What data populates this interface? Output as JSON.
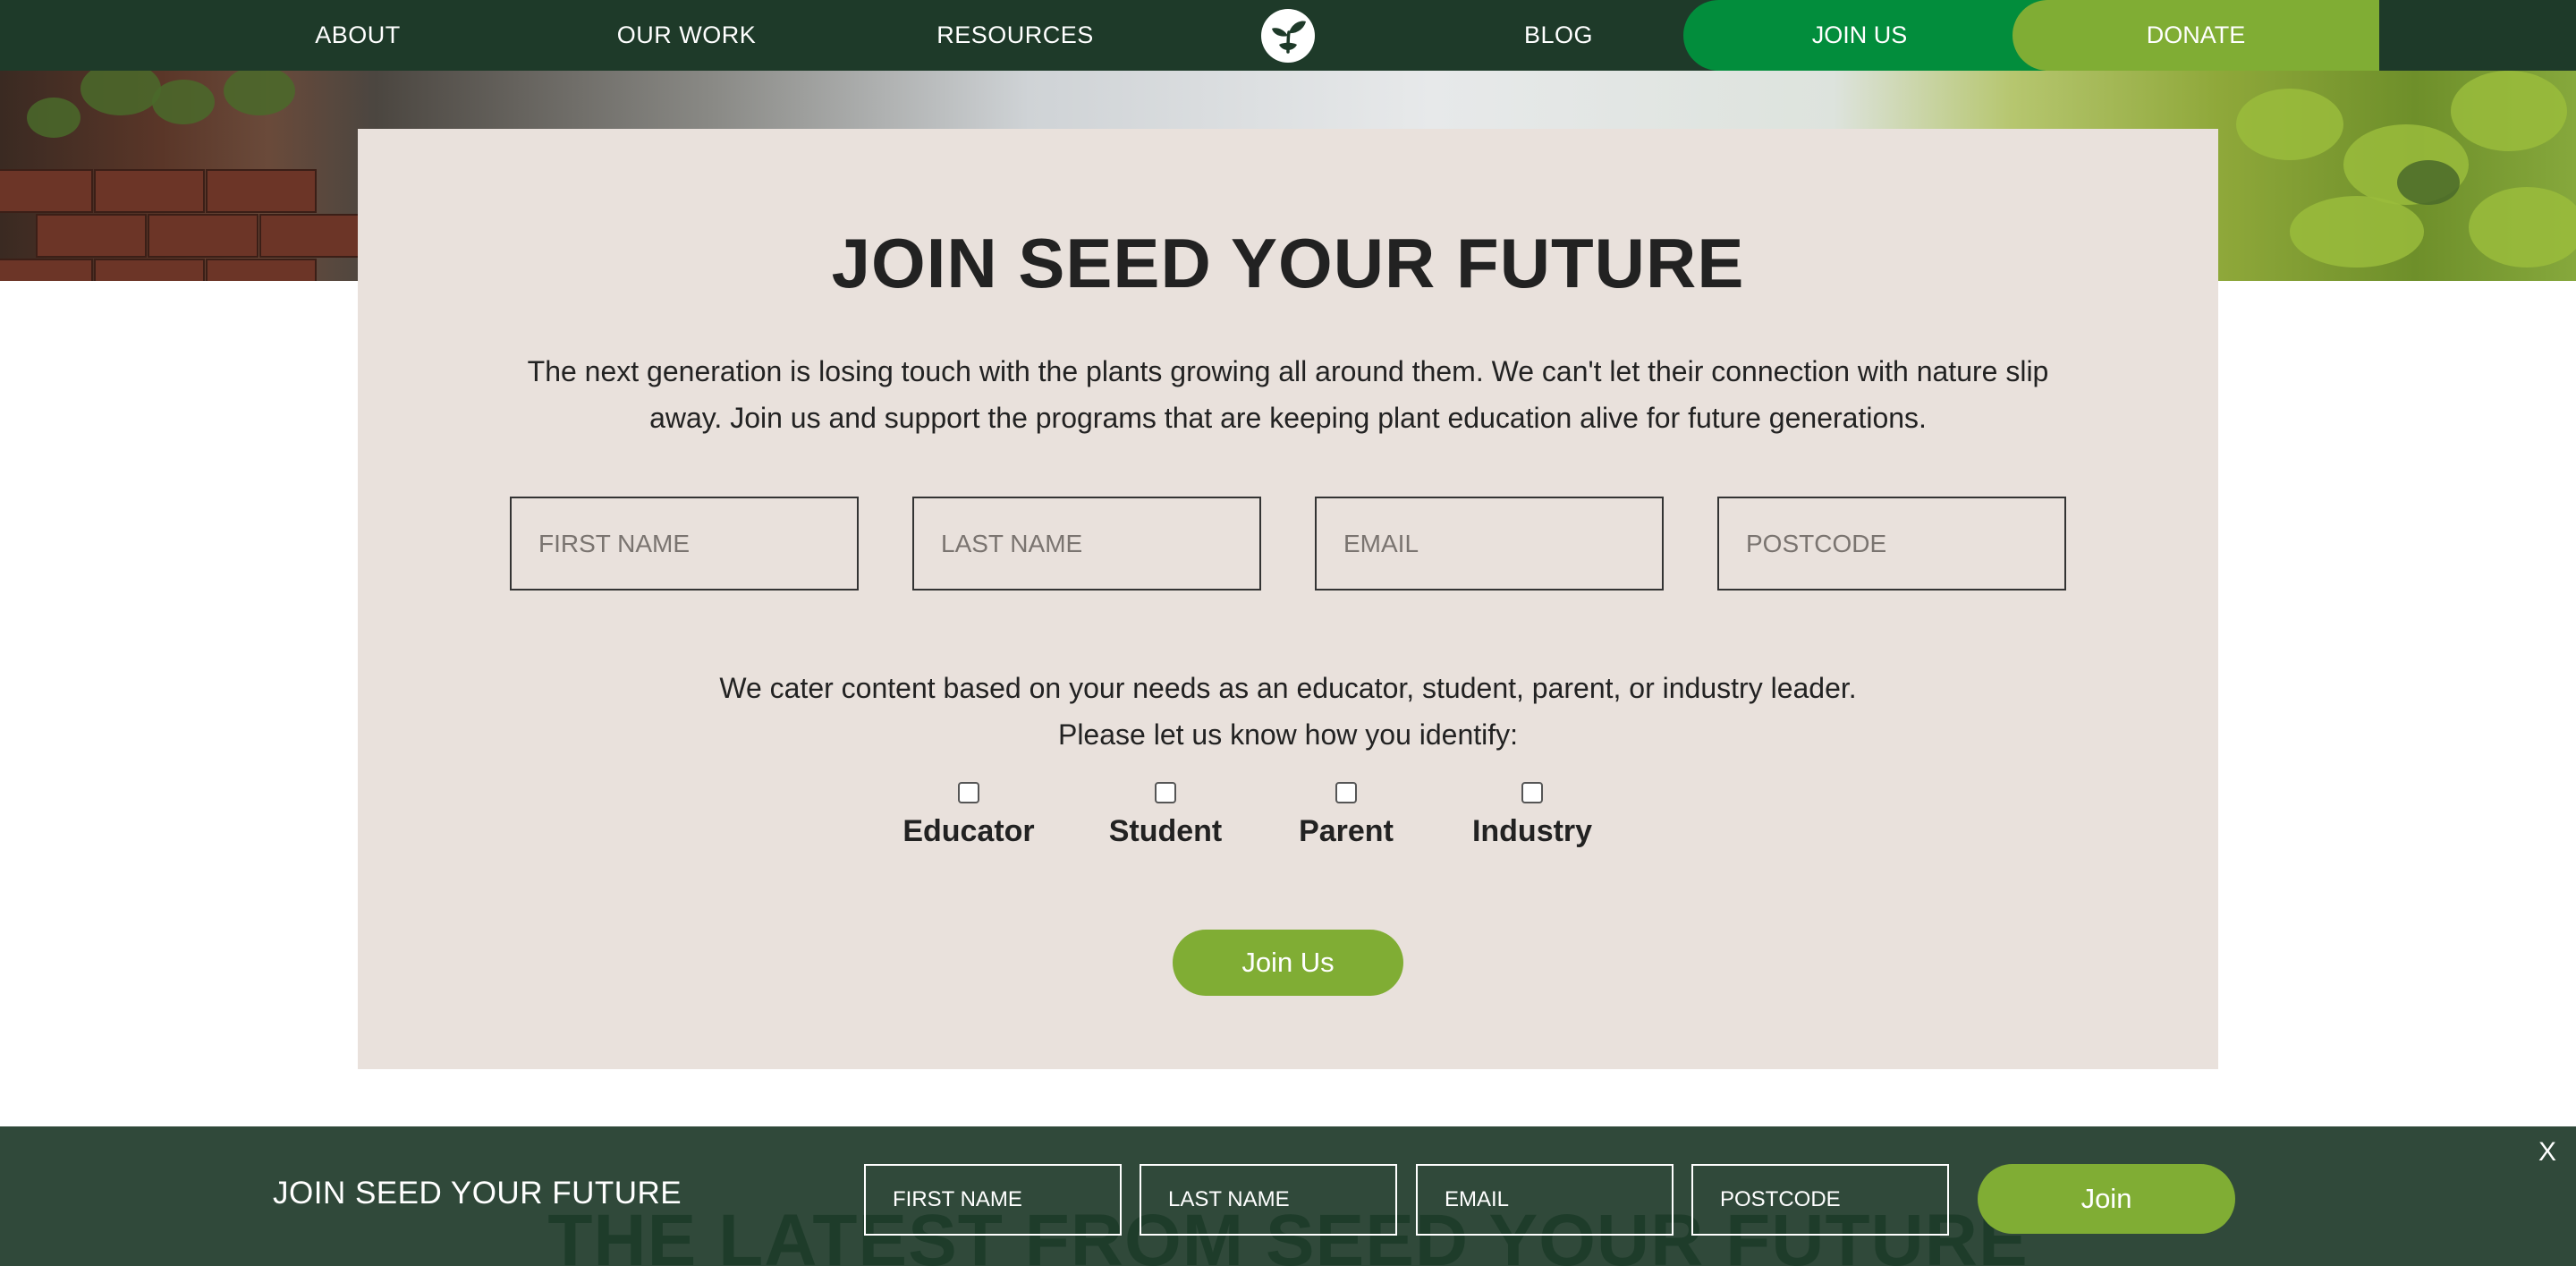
{
  "nav": {
    "about": "ABOUT",
    "our_work": "OUR WORK",
    "resources": "RESOURCES",
    "blog": "BLOG",
    "join_us": "JOIN US",
    "donate": "DONATE",
    "logo_icon": "sprout-logo-icon"
  },
  "join_card": {
    "title": "JOIN SEED YOUR FUTURE",
    "intro": "The next generation is losing touch with the plants growing all around them. We can't let their connection with nature slip away. Join us and support the programs that are keeping plant education alive for future generations.",
    "fields": {
      "first_name": "FIRST NAME",
      "last_name": "LAST NAME",
      "email": "EMAIL",
      "postcode": "POSTCODE"
    },
    "cater_line1": "We cater content based on your needs as an educator, student, parent, or industry leader.",
    "cater_line2": "Please let us know how you identify:",
    "identify_options": [
      "Educator",
      "Student",
      "Parent",
      "Industry"
    ],
    "submit_label": "Join Us"
  },
  "background_section": {
    "heading": "THE LATEST FROM SEED YOUR FUTURE"
  },
  "sticky_bar": {
    "title": "JOIN SEED YOUR FUTURE",
    "fields": {
      "first_name": "FIRST NAME",
      "last_name": "LAST NAME",
      "email": "EMAIL",
      "postcode": "POSTCODE"
    },
    "submit_label": "Join",
    "close_label": "X"
  },
  "colors": {
    "nav_bg": "#1e3a29",
    "join_green": "#028d3c",
    "accent_lime": "#80ad34",
    "card_bg": "#e9e1dc"
  }
}
